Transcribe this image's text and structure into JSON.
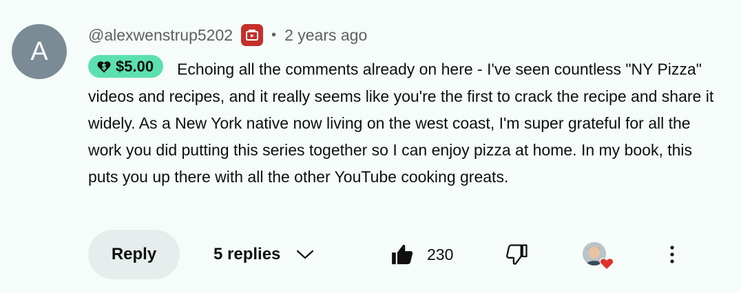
{
  "comment": {
    "avatar_letter": "A",
    "avatar_color": "#7b8b96",
    "author": "@alexwenstrup5202",
    "member_badge_icon": "membership-badge-icon",
    "separator": "•",
    "timestamp": "2 years ago",
    "super_thanks": {
      "icon": "super-thanks-heart-dollar-icon",
      "amount": "$5.00",
      "color": "#5ce0b0"
    },
    "text": "Echoing all the comments already on here - I've seen countless \"NY Pizza\" videos and recipes, and it really seems like you're the first to crack the recipe and share it widely. As a New York native now living on the west coast, I'm super grateful for all the work you did putting this series together so I can enjoy pizza at home. In my book, this puts you up there with all the other YouTube cooking greats."
  },
  "actions": {
    "reply_label": "Reply",
    "replies_label": "5 replies",
    "replies_icon": "chevron-down-icon",
    "like_icon": "thumbs-up-filled-icon",
    "like_count": "230",
    "dislike_icon": "thumbs-down-outline-icon",
    "creator_heart_icon": "creator-heart-icon",
    "more_icon": "more-vertical-icon"
  }
}
